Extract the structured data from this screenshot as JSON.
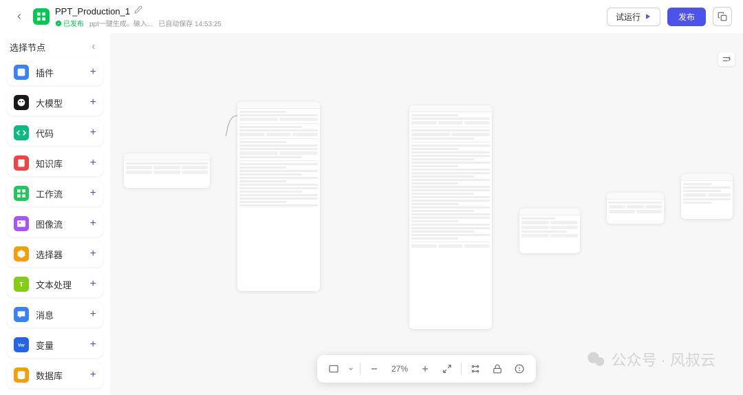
{
  "header": {
    "title": "PPT_Production_1",
    "published_label": "已发布",
    "description": "ppt一键生成。输入...",
    "autosave": "已自动保存 14:53:25",
    "test_label": "试运行",
    "publish_label": "发布"
  },
  "sidebar": {
    "title": "选择节点",
    "items": [
      {
        "label": "插件",
        "color": "#3b82f6",
        "icon": "plugin"
      },
      {
        "label": "大模型",
        "color": "#1a1a1a",
        "icon": "llm"
      },
      {
        "label": "代码",
        "color": "#10b981",
        "icon": "code"
      },
      {
        "label": "知识库",
        "color": "#ef4444",
        "icon": "knowledge"
      },
      {
        "label": "工作流",
        "color": "#22c55e",
        "icon": "workflow"
      },
      {
        "label": "图像流",
        "color": "#a855f7",
        "icon": "imageflow"
      },
      {
        "label": "选择器",
        "color": "#f59e0b",
        "icon": "selector"
      },
      {
        "label": "文本处理",
        "color": "#84cc16",
        "icon": "text"
      },
      {
        "label": "消息",
        "color": "#3b82f6",
        "icon": "message"
      },
      {
        "label": "变量",
        "color": "#2563eb",
        "icon": "variable"
      },
      {
        "label": "数据库",
        "color": "#f59e0b",
        "icon": "database"
      }
    ]
  },
  "canvas": {
    "zoom": "27%"
  },
  "watermark": {
    "text": "公众号 · 风叔云"
  }
}
